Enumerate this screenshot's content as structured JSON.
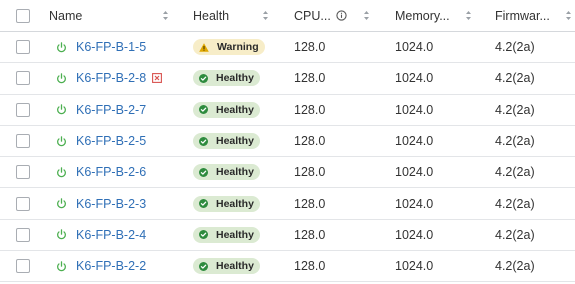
{
  "columns": {
    "name": "Name",
    "health": "Health",
    "cpu": "CPU...",
    "memory": "Memory...",
    "firmware": "Firmwar..."
  },
  "rows": [
    {
      "name": "K6-FP-B-1-5",
      "health": "Warning",
      "status": "warning",
      "cpu": "128.0",
      "memory": "1024.0",
      "firmware": "4.2(2a)",
      "error": false
    },
    {
      "name": "K6-FP-B-2-8",
      "health": "Healthy",
      "status": "healthy",
      "cpu": "128.0",
      "memory": "1024.0",
      "firmware": "4.2(2a)",
      "error": true
    },
    {
      "name": "K6-FP-B-2-7",
      "health": "Healthy",
      "status": "healthy",
      "cpu": "128.0",
      "memory": "1024.0",
      "firmware": "4.2(2a)",
      "error": false
    },
    {
      "name": "K6-FP-B-2-5",
      "health": "Healthy",
      "status": "healthy",
      "cpu": "128.0",
      "memory": "1024.0",
      "firmware": "4.2(2a)",
      "error": false
    },
    {
      "name": "K6-FP-B-2-6",
      "health": "Healthy",
      "status": "healthy",
      "cpu": "128.0",
      "memory": "1024.0",
      "firmware": "4.2(2a)",
      "error": false
    },
    {
      "name": "K6-FP-B-2-3",
      "health": "Healthy",
      "status": "healthy",
      "cpu": "128.0",
      "memory": "1024.0",
      "firmware": "4.2(2a)",
      "error": false
    },
    {
      "name": "K6-FP-B-2-4",
      "health": "Healthy",
      "status": "healthy",
      "cpu": "128.0",
      "memory": "1024.0",
      "firmware": "4.2(2a)",
      "error": false
    },
    {
      "name": "K6-FP-B-2-2",
      "health": "Healthy",
      "status": "healthy",
      "cpu": "128.0",
      "memory": "1024.0",
      "firmware": "4.2(2a)",
      "error": false
    }
  ],
  "icons": {
    "power": "power-icon",
    "healthy": "check-circle-icon",
    "warning": "warning-triangle-icon",
    "error": "error-square-icon",
    "info": "info-icon",
    "sort": "sort-arrows-icon"
  },
  "colors": {
    "link": "#2f6fb6",
    "power": "#4caf50",
    "healthy_bg": "#dbead2",
    "healthy_icon": "#2e8b3e",
    "warning_bg": "#f7edc8",
    "warning_icon": "#e0a800",
    "error": "#d9534f"
  }
}
